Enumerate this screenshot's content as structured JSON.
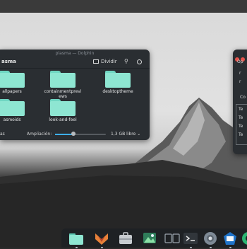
{
  "dolphin": {
    "title": "plasma — Dolphin",
    "location": "asma",
    "split_label": "Dividir",
    "folders": [
      {
        "name": "allpapers"
      },
      {
        "name": "containmentpreviews"
      },
      {
        "name": "desktoptheme"
      },
      {
        "name": "asmoids"
      },
      {
        "name": "look-and-feel"
      }
    ],
    "status": {
      "left_text": "as",
      "zoom_label": "Ampliación:",
      "zoom_fraction": 0.36,
      "free_space": "1,3 GB libre"
    }
  },
  "dialog": {
    "labels": [
      "Op",
      "r",
      "r",
      "Co",
      "Te",
      "Te",
      "Te",
      "Te"
    ]
  },
  "colors": {
    "folder": "#8ee6d2",
    "window_bg": "#2a2e32",
    "accent": "#3daee9",
    "dock_bg": "#1e2124"
  },
  "dock": {
    "items": [
      {
        "icon": "file-manager-icon",
        "active": true
      },
      {
        "icon": "firefox-icon",
        "active": true
      },
      {
        "icon": "briefcase-icon",
        "active": false
      },
      {
        "icon": "image-viewer-icon",
        "active": false
      },
      {
        "icon": "task-view-icon",
        "active": false
      },
      {
        "icon": "terminal-icon",
        "active": true
      },
      {
        "icon": "settings-icon",
        "active": true
      },
      {
        "icon": "pager-icon",
        "active": true
      },
      {
        "icon": "system-tray-icon",
        "active": false
      }
    ]
  }
}
